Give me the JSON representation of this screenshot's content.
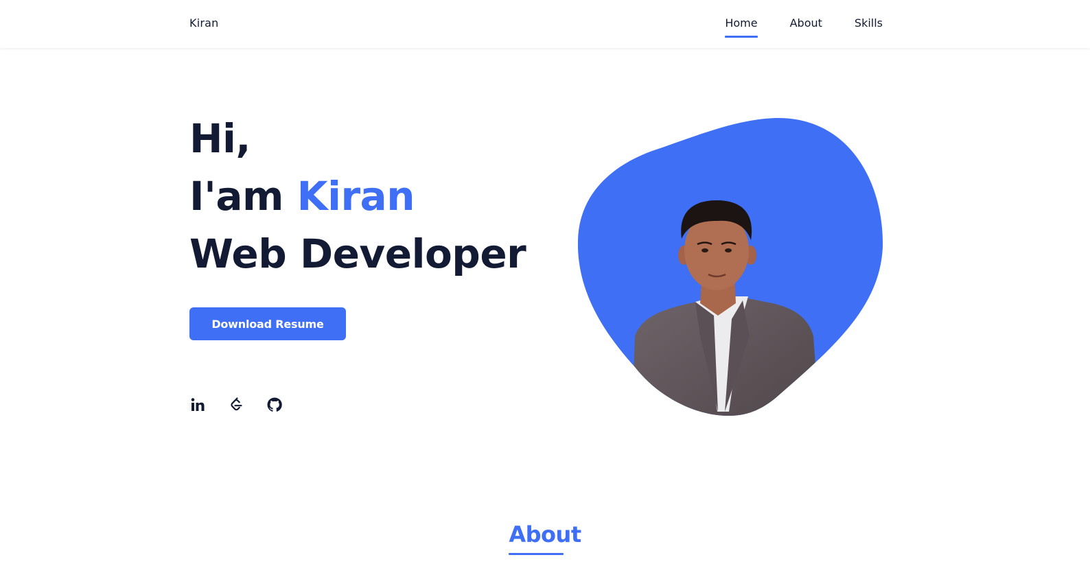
{
  "header": {
    "logo": "Kiran",
    "nav": [
      {
        "label": "Home",
        "active": true
      },
      {
        "label": "About",
        "active": false
      },
      {
        "label": "Skills",
        "active": false
      }
    ]
  },
  "hero": {
    "greeting": "Hi,",
    "intro_prefix": "I'am",
    "name": "Kiran",
    "role": "Web Developer",
    "button_label": "Download Resume",
    "socials": [
      {
        "icon": "linkedin-icon"
      },
      {
        "icon": "leetcode-icon"
      },
      {
        "icon": "github-icon"
      }
    ]
  },
  "about": {
    "title": "About"
  },
  "colors": {
    "accent": "#3e6ff4",
    "text": "#121b33",
    "background": "#ffffff"
  }
}
